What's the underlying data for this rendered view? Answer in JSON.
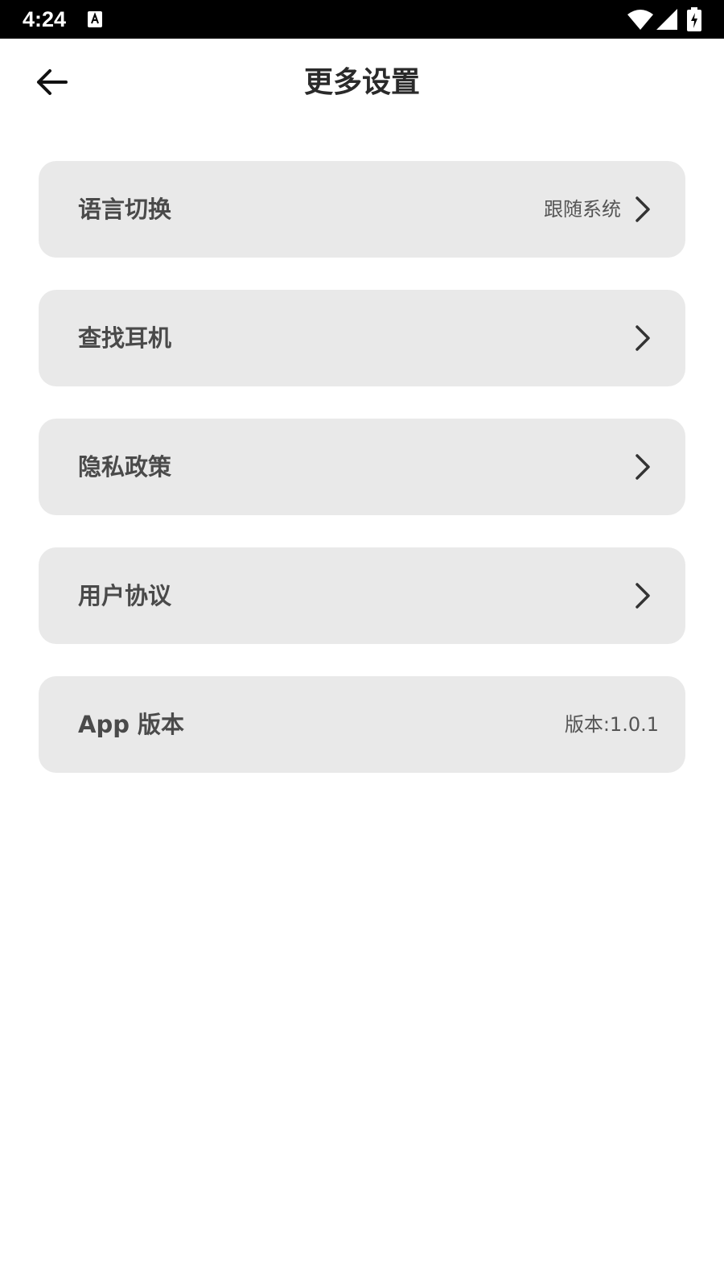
{
  "status_bar": {
    "time": "4:24",
    "icons": [
      "notification-a-icon",
      "wifi-icon",
      "signal-icon",
      "battery-charging-icon"
    ]
  },
  "header": {
    "title": "更多设置",
    "back_icon": "arrow-left-icon"
  },
  "settings": {
    "items": [
      {
        "label": "语言切换",
        "value": "跟随系统",
        "chevron": true
      },
      {
        "label": "查找耳机",
        "value": "",
        "chevron": true
      },
      {
        "label": "隐私政策",
        "value": "",
        "chevron": true
      },
      {
        "label": "用户协议",
        "value": "",
        "chevron": true
      },
      {
        "label": "App 版本",
        "value": "版本:1.0.1",
        "chevron": false
      }
    ]
  },
  "colors": {
    "background": "#ffffff",
    "status_bar": "#000000",
    "row_background": "#e9e9e9",
    "label_text": "#4a4a4a",
    "title_text": "#2a2a2a"
  }
}
